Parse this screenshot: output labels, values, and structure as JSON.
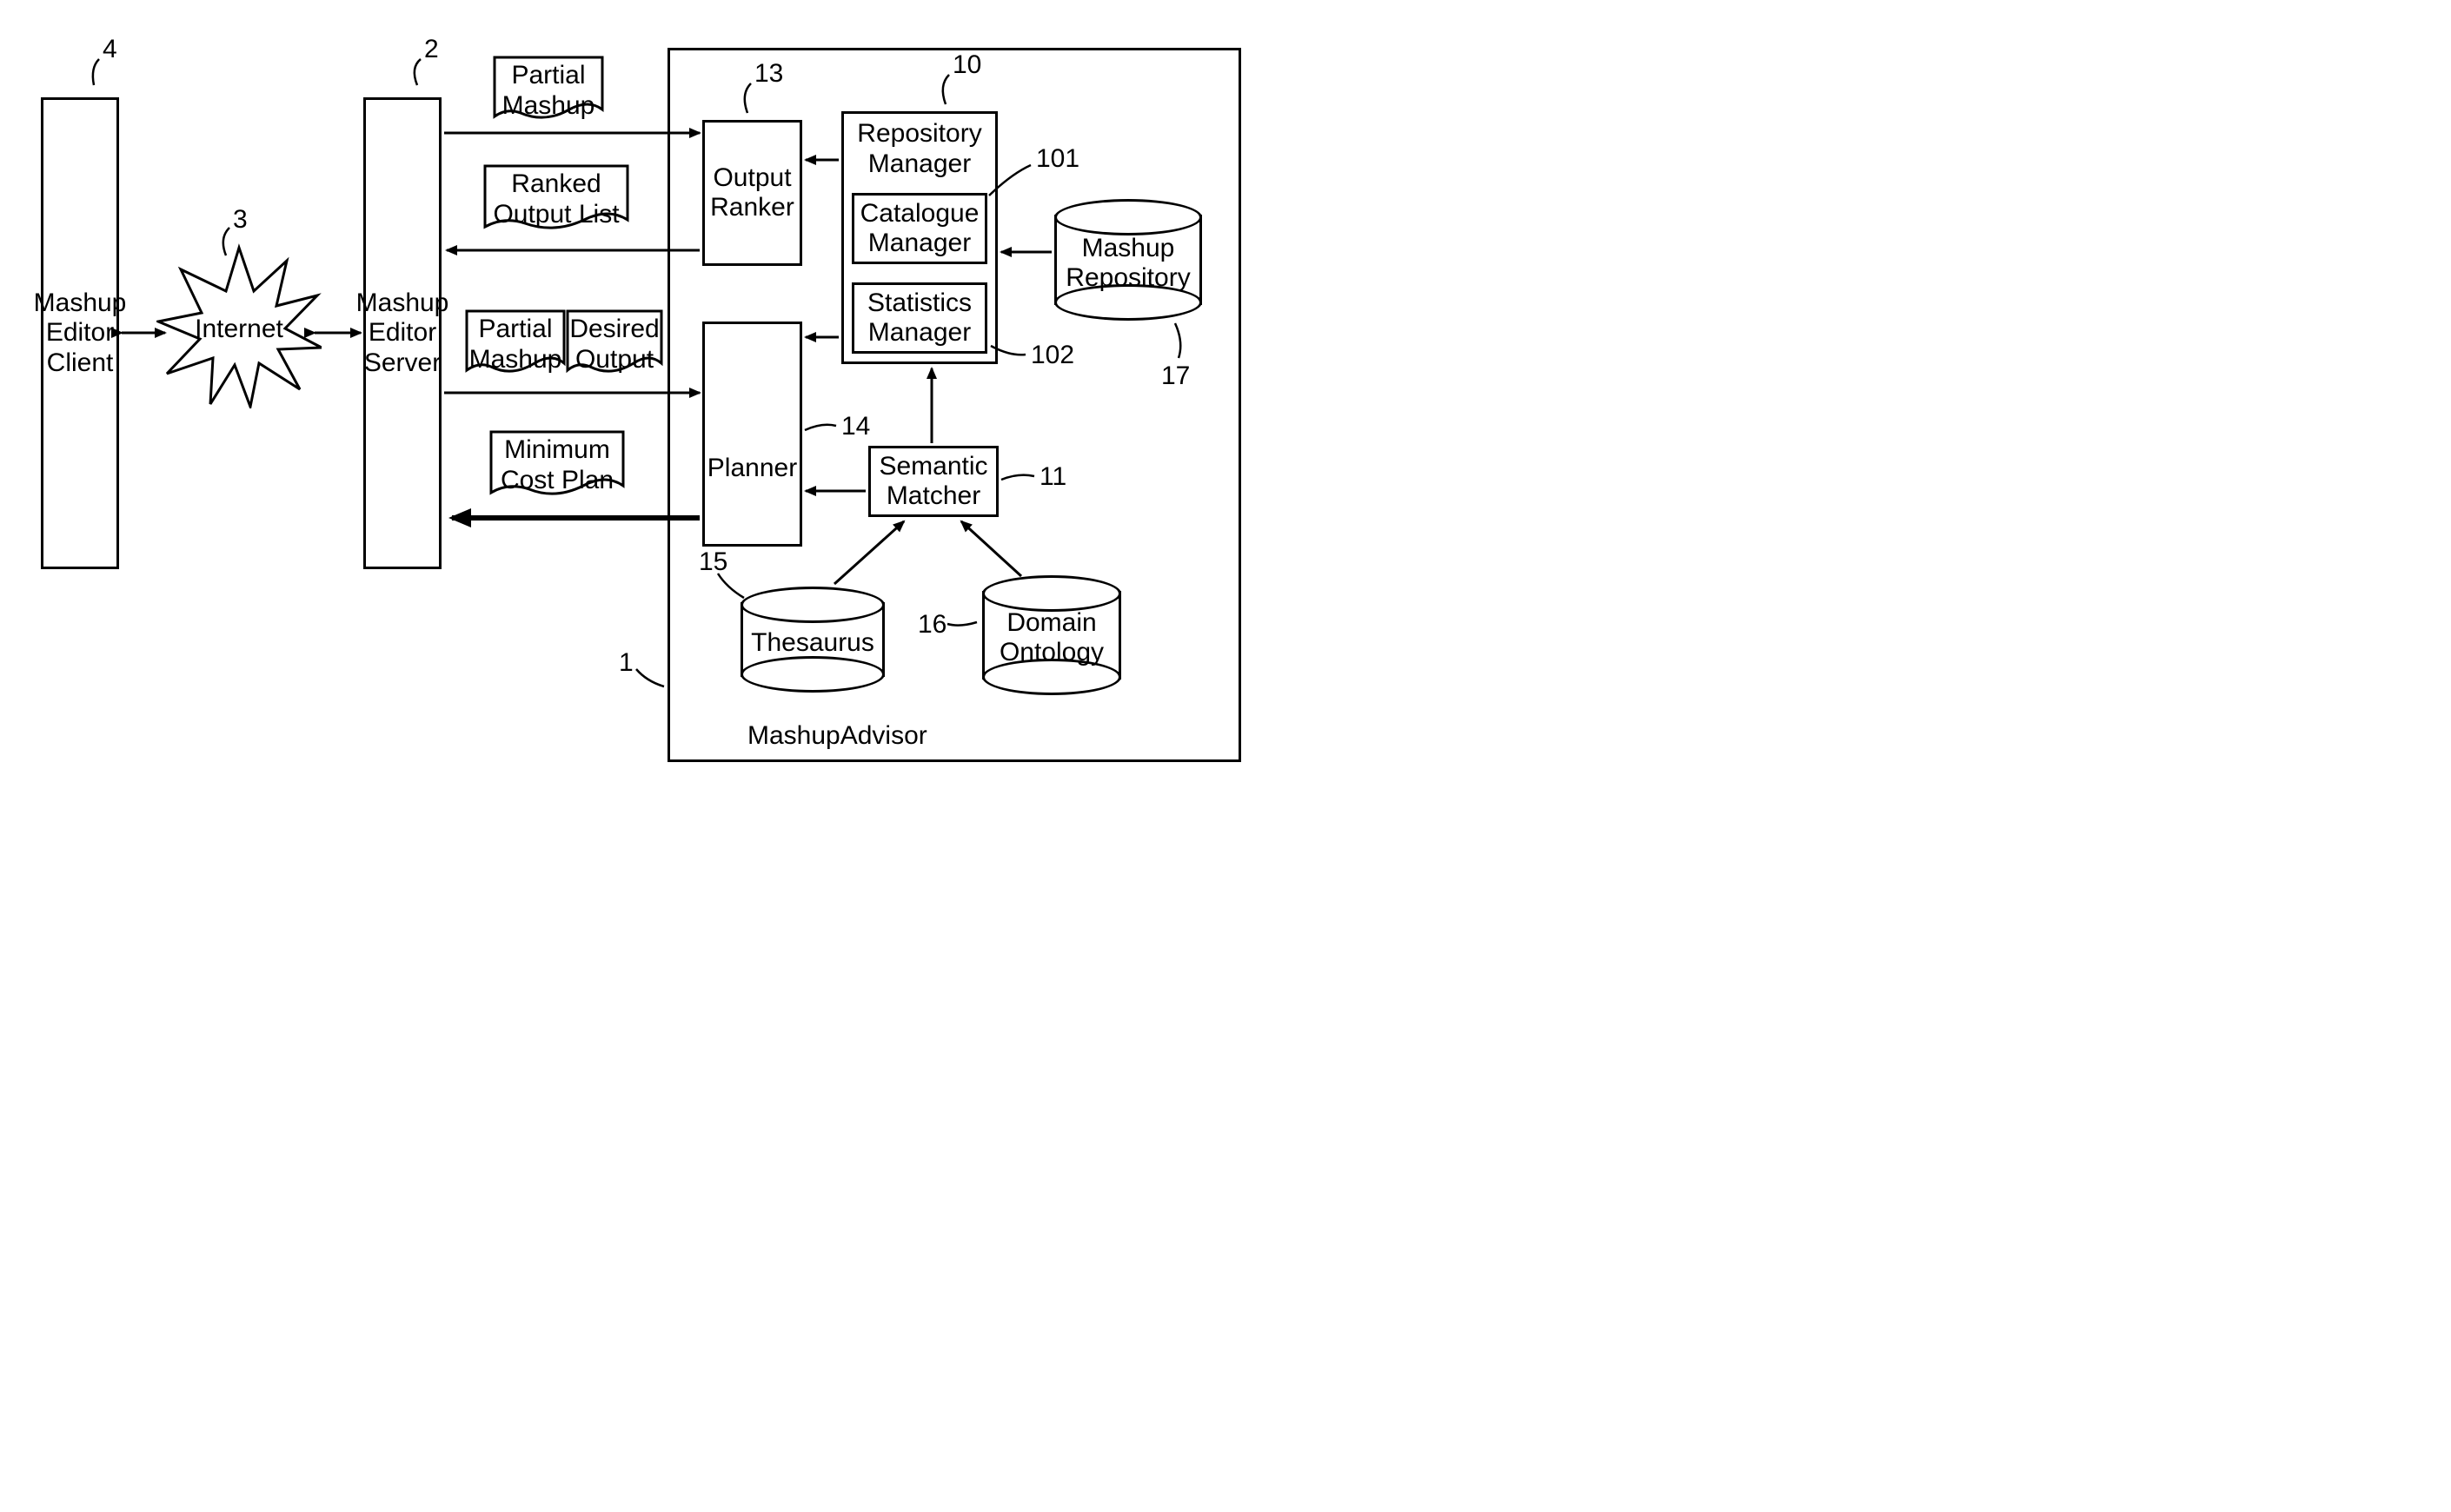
{
  "client": {
    "label": "Mashup\nEditor\nClient",
    "num": "4"
  },
  "internet": {
    "label": "Internet",
    "num": "3"
  },
  "server": {
    "label": "Mashup\nEditor\nServer",
    "num": "2"
  },
  "advisor": {
    "label": "MashupAdvisor",
    "num": "1"
  },
  "docs": {
    "partial_mashup_top": "Partial\nMashup",
    "ranked_output_list": "Ranked\nOutput List",
    "partial_mashup_left": "Partial\nMashup",
    "desired_output": "Desired\nOutput",
    "min_cost_plan": "Minimum\nCost Plan"
  },
  "ranker": {
    "label": "Output\nRanker",
    "num": "13"
  },
  "planner": {
    "label": "Planner",
    "num": "14"
  },
  "repo_mgr": {
    "label": "Repository\nManager",
    "num": "10"
  },
  "catalog_mgr": {
    "label": "Catalogue\nManager",
    "num": "101"
  },
  "stats_mgr": {
    "label": "Statistics\nManager",
    "num": "102"
  },
  "sem_matcher": {
    "label": "Semantic\nMatcher",
    "num": "11"
  },
  "thesaurus": {
    "label": "Thesaurus",
    "num": "15"
  },
  "domain_ont": {
    "label": "Domain\nOntology",
    "num": "16"
  },
  "mashup_repo": {
    "label": "Mashup\nRepository",
    "num": "17"
  }
}
